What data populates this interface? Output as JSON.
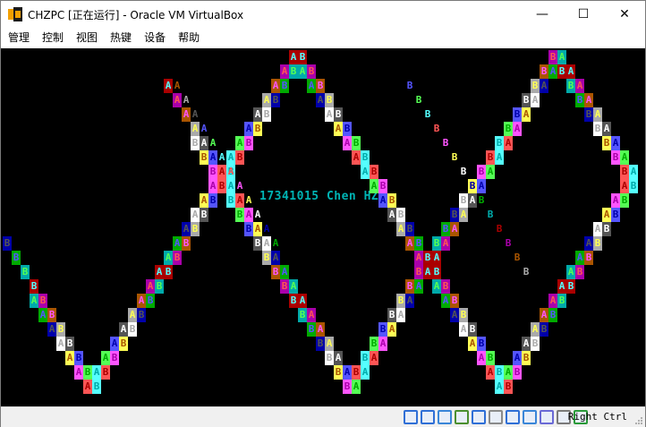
{
  "window": {
    "title": "CHZPC [正在运行] - Oracle VM VirtualBox",
    "minimize": "—",
    "maximize": "☐",
    "close": "✕"
  },
  "menu": {
    "items": [
      "管理",
      "控制",
      "视图",
      "热键",
      "设备",
      "帮助"
    ]
  },
  "screen": {
    "banner": "17341015 Chen HZ!",
    "background": "#000000"
  },
  "status": {
    "host_key": "Right Ctrl",
    "icons": [
      "hard-disk-icon",
      "optical-drive-icon",
      "audio-icon",
      "network-icon",
      "usb-icon",
      "shared-folder-icon",
      "display-icon",
      "video-capture-icon",
      "virtualization-icon",
      "mouse-integration-icon",
      "host-key-icon"
    ]
  }
}
